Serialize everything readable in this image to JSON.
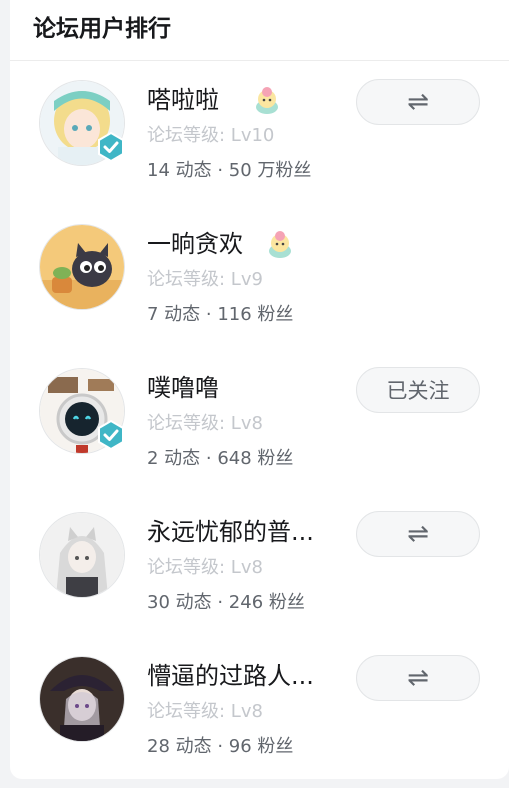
{
  "panel": {
    "title": "论坛用户排行"
  },
  "users": [
    {
      "name": "嗒啦啦",
      "level": "论坛等级: Lv10",
      "stats": "14 动态 · 50 万粉丝",
      "verified": true,
      "has_badge": true,
      "action": "swap",
      "action_label": "⇌"
    },
    {
      "name": "一晌贪欢",
      "level": "论坛等级: Lv9",
      "stats": "7 动态 · 116 粉丝",
      "verified": false,
      "has_badge": true,
      "action": "none",
      "action_label": ""
    },
    {
      "name": "噗噜噜",
      "level": "论坛等级: Lv8",
      "stats": "2 动态 · 648 粉丝",
      "verified": true,
      "has_badge": false,
      "action": "followed",
      "action_label": "已关注"
    },
    {
      "name": "永远忧郁的普...",
      "level": "论坛等级: Lv8",
      "stats": "30 动态 · 246 粉丝",
      "verified": false,
      "has_badge": false,
      "action": "swap",
      "action_label": "⇌"
    },
    {
      "name": "懵逼的过路人...",
      "level": "论坛等级: Lv8",
      "stats": "28 动态 · 96 粉丝",
      "verified": false,
      "has_badge": false,
      "action": "swap",
      "action_label": "⇌"
    }
  ],
  "colors": {
    "verify_badge": "#3fb6c6",
    "button_bg": "#f6f7f8",
    "level_text": "#c4c7cc",
    "stats_text": "#61666d"
  }
}
